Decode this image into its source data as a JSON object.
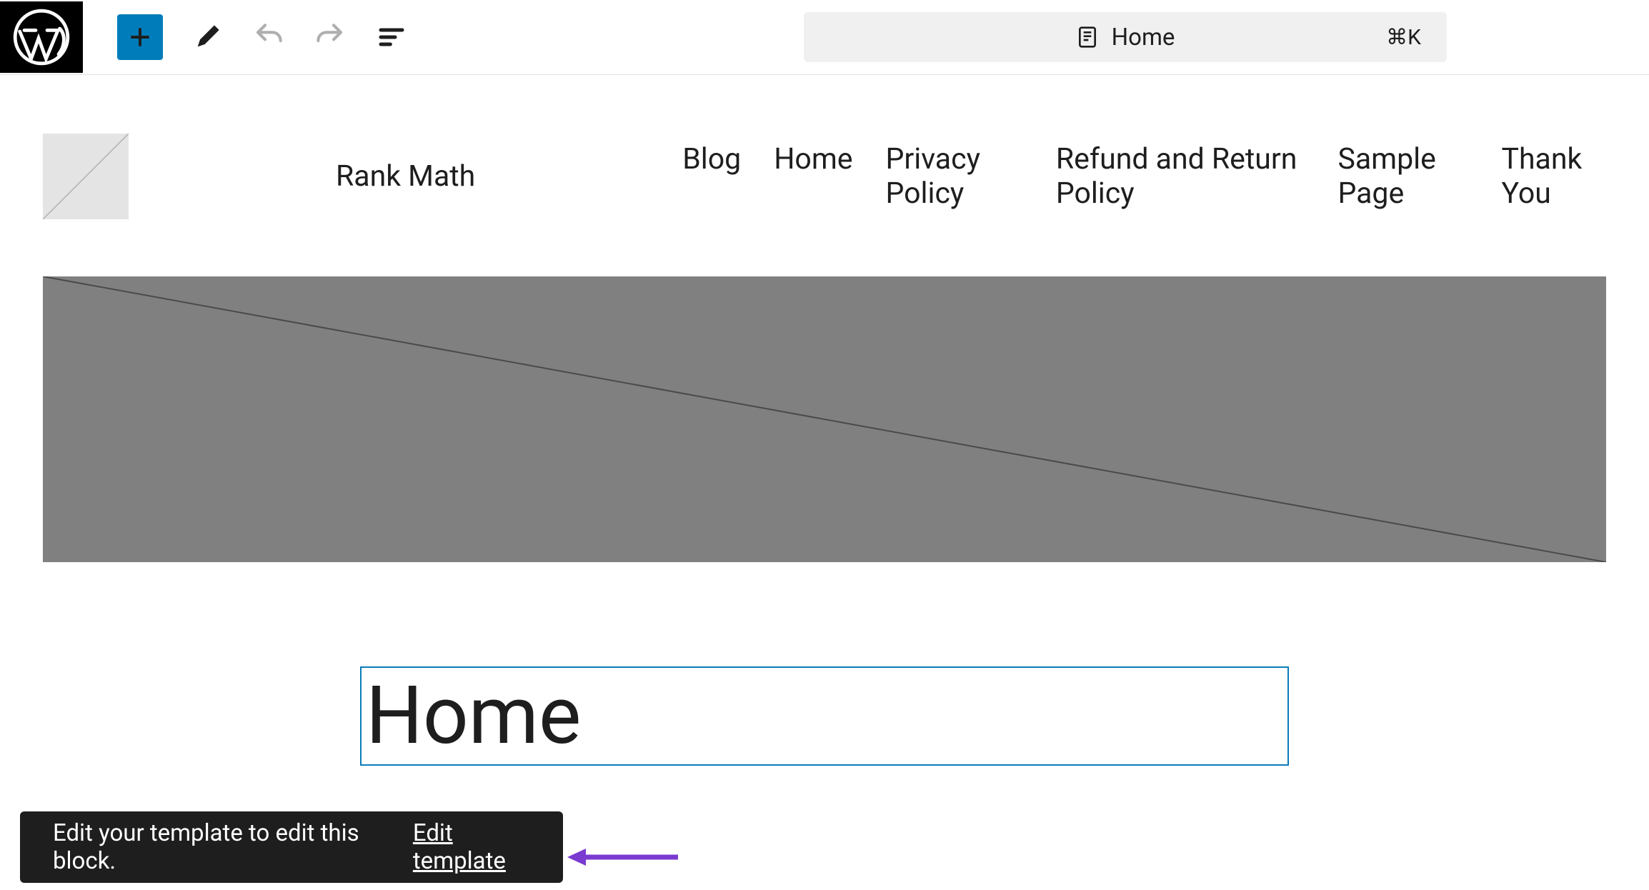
{
  "toolbar": {
    "page_label": "Home",
    "shortcut": "⌘K"
  },
  "site": {
    "title": "Rank Math",
    "nav": [
      "Blog",
      "Home",
      "Privacy Policy",
      "Refund and Return Policy",
      "Sample Page",
      "Thank You"
    ]
  },
  "page": {
    "title": "Home"
  },
  "snackbar": {
    "message": "Edit your template to edit this block.",
    "action": "Edit template"
  }
}
